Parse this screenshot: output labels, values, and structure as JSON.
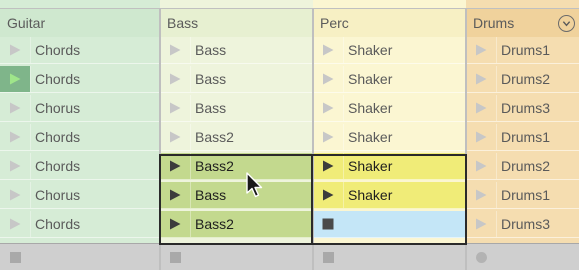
{
  "colors": {
    "guitar_bg": "#d6ecd6",
    "guitar_hdr": "#cfe8cf",
    "bass_bg": "#eef4dc",
    "bass_hdr": "#e7f0d1",
    "perc_bg": "#fbf6d2",
    "perc_hdr": "#f7f0c4",
    "drums_bg": "#f5ddb0",
    "drums_hdr": "#f0d29c",
    "bass_active": "#c3d98e",
    "perc_active": "#f0ec78",
    "perc_empty": "#c4e6f7",
    "playing_green": "#9fe58a",
    "arrow_idle": "#c7c7c7",
    "arrow_active": "#3c3c3c"
  },
  "tracks": [
    {
      "name": "Guitar",
      "clips": [
        {
          "label": "Chords"
        },
        {
          "label": "Chords",
          "playing": true
        },
        {
          "label": "Chorus"
        },
        {
          "label": "Chords"
        },
        {
          "label": "Chords"
        },
        {
          "label": "Chorus"
        },
        {
          "label": "Chords"
        }
      ]
    },
    {
      "name": "Bass",
      "clips": [
        {
          "label": "Bass"
        },
        {
          "label": "Bass"
        },
        {
          "label": "Bass"
        },
        {
          "label": "Bass2"
        },
        {
          "label": "Bass2",
          "selected": true
        },
        {
          "label": "Bass",
          "selected": true
        },
        {
          "label": "Bass2",
          "selected": true
        }
      ]
    },
    {
      "name": "Perc",
      "clips": [
        {
          "label": "Shaker"
        },
        {
          "label": "Shaker"
        },
        {
          "label": "Shaker"
        },
        {
          "label": "Shaker"
        },
        {
          "label": "Shaker",
          "selected": true
        },
        {
          "label": "Shaker",
          "selected": true
        },
        {
          "label": "",
          "selected": true,
          "empty": true
        }
      ]
    },
    {
      "name": "Drums",
      "has_menu": true,
      "menu_icon": "chevron-down-icon",
      "clips": [
        {
          "label": "Drums1"
        },
        {
          "label": "Drums2"
        },
        {
          "label": "Drums3"
        },
        {
          "label": "Drums1"
        },
        {
          "label": "Drums2"
        },
        {
          "label": "Drums1"
        },
        {
          "label": "Drums3"
        }
      ]
    }
  ],
  "footer": [
    {
      "icon": "stop-icon"
    },
    {
      "icon": "stop-icon"
    },
    {
      "icon": "stop-icon"
    },
    {
      "icon": "dot-icon"
    }
  ],
  "cursor_icon": "mouse-pointer-icon"
}
